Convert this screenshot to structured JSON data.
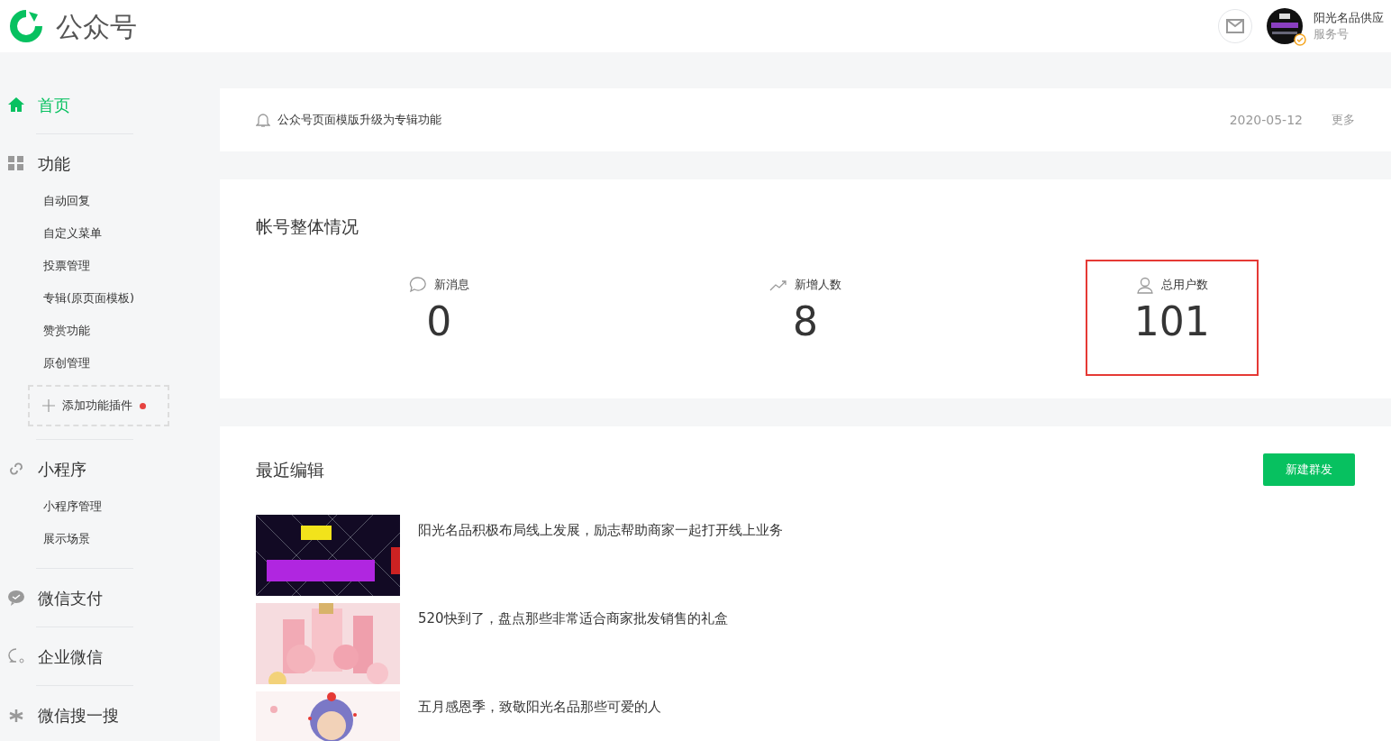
{
  "header": {
    "product": "公众号",
    "account_name": "阳光名品供应",
    "account_type": "服务号",
    "verified": true
  },
  "sidebar": [
    {
      "label": "首页",
      "selected": true
    },
    {
      "label": "功能",
      "selected": false,
      "children": [
        {
          "label": "自动回复"
        },
        {
          "label": "自定义菜单"
        },
        {
          "label": "投票管理"
        },
        {
          "label": "专辑(原页面模板)"
        },
        {
          "label": "赞赏功能"
        },
        {
          "label": "原创管理"
        }
      ],
      "add_button": {
        "label": "添加功能插件",
        "dot": true
      }
    },
    {
      "label": "小程序",
      "selected": false,
      "children": [
        {
          "label": "小程序管理"
        },
        {
          "label": "展示场景"
        }
      ]
    },
    {
      "label": "微信支付",
      "selected": false
    },
    {
      "label": "企业微信",
      "selected": false
    },
    {
      "label": "微信搜一搜",
      "selected": false
    }
  ],
  "notice": {
    "text": "公众号页面模版升级为专辑功能",
    "date": "2020-05-12",
    "more": "更多"
  },
  "overview": {
    "title": "帐号整体情况",
    "stats": [
      {
        "label": "新消息",
        "value": "0",
        "highlighted": false
      },
      {
        "label": "新增人数",
        "value": "8",
        "highlighted": false
      },
      {
        "label": "总用户数",
        "value": "101",
        "highlighted": true
      }
    ]
  },
  "recent": {
    "title": "最近编辑",
    "button": "新建群发",
    "articles": [
      {
        "title": "阳光名品积极布局线上发展，励志帮助商家一起打开线上业务",
        "kind": "picture"
      },
      {
        "title": "520快到了，盘点那些非常适合商家批发销售的礼盒",
        "kind": "picture"
      },
      {
        "title": "五月感恩季，致敬阳光名品那些可爱的人",
        "kind": "picture"
      }
    ]
  }
}
